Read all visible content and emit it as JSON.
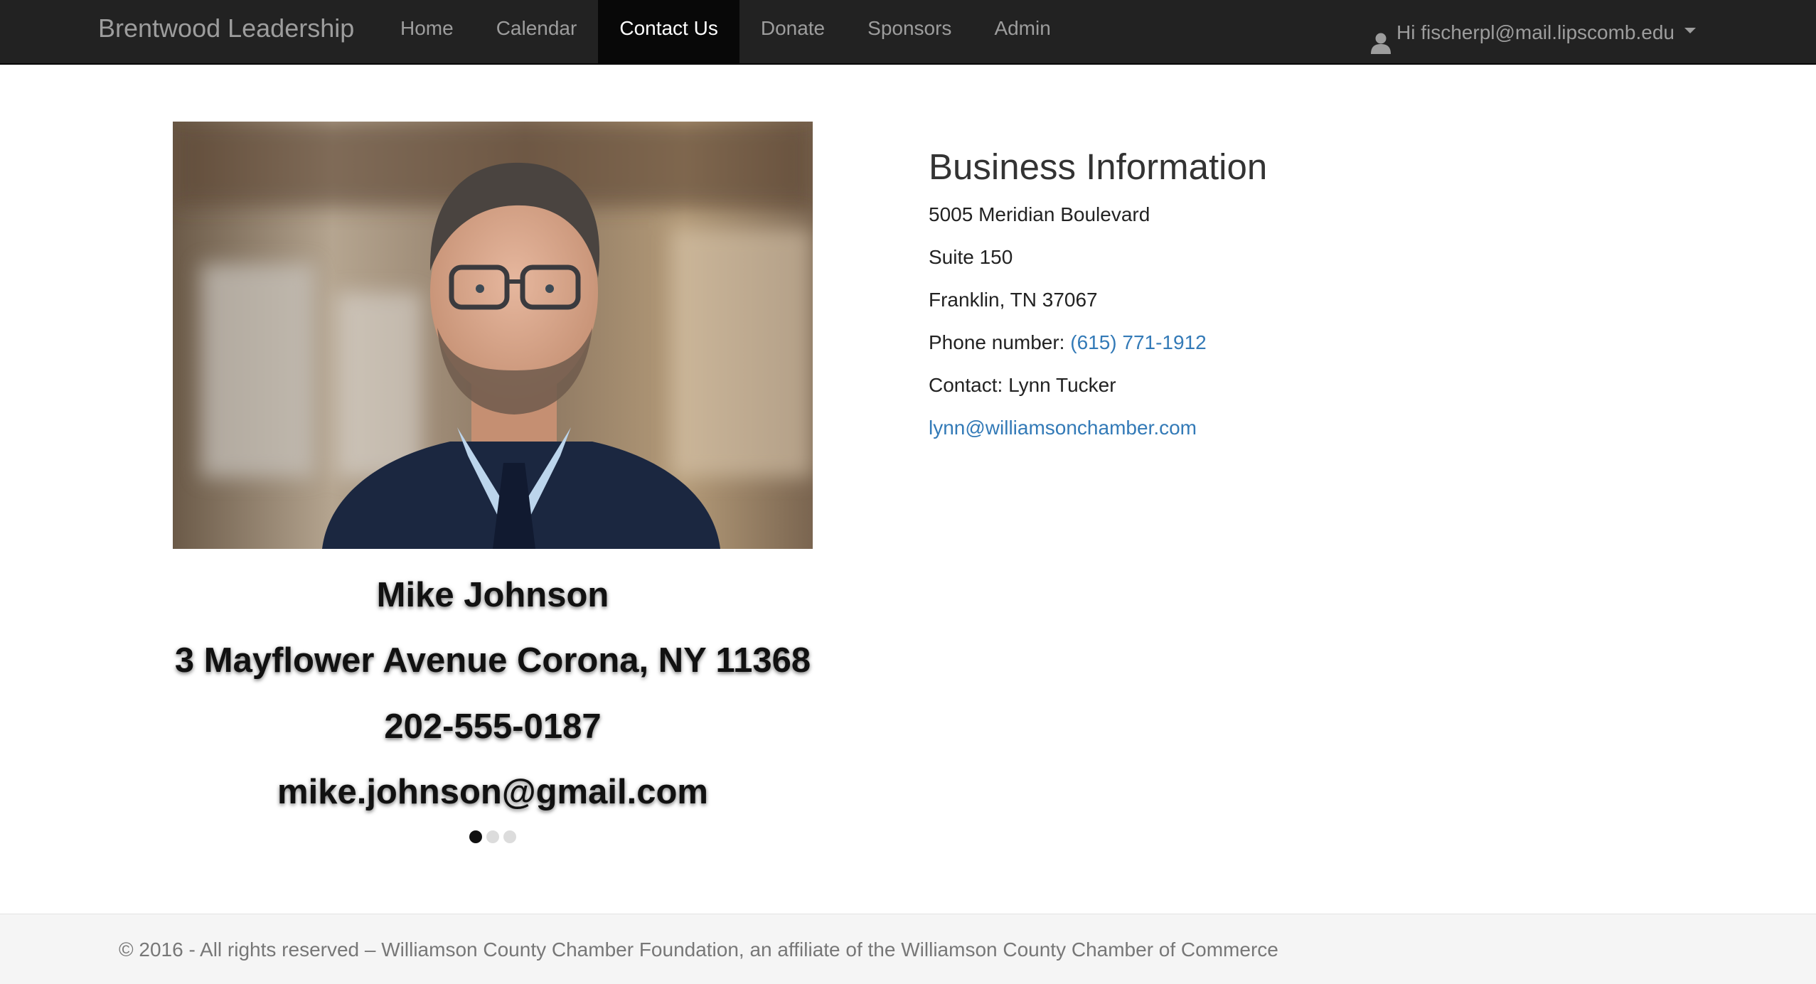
{
  "navbar": {
    "brand": "Brentwood Leadership",
    "items": [
      {
        "label": "Home"
      },
      {
        "label": "Calendar"
      },
      {
        "label": "Contact Us",
        "active": true
      },
      {
        "label": "Donate"
      },
      {
        "label": "Sponsors"
      },
      {
        "label": "Admin"
      }
    ],
    "user_greeting": "Hi fischerpl@mail.lipscomb.edu"
  },
  "carousel": {
    "name": "Mike Johnson",
    "address": "3 Mayflower Avenue Corona, NY 11368",
    "phone": "202-555-0187",
    "email": "mike.johnson@gmail.com",
    "slide_count": 3,
    "active_slide": 1
  },
  "business": {
    "title": "Business Information",
    "street": "5005 Meridian Boulevard",
    "suite": "Suite 150",
    "city": "Franklin, TN 37067",
    "phone_label": "Phone number:",
    "phone": "(615) 771-1912",
    "contact_label": "Contact:",
    "contact_name": "Lynn Tucker",
    "email": "lynn@williamsonchamber.com"
  },
  "footer": {
    "text": "© 2016 - All rights reserved – Williamson County Chamber Foundation, an affiliate of the Williamson County Chamber of Commerce"
  },
  "colors": {
    "navbar_bg": "#222222",
    "nav_active_bg": "#080808",
    "link": "#337ab7",
    "footer_bg": "#f5f5f5"
  },
  "icons": {
    "user": "user-icon",
    "caret": "caret-down-icon"
  }
}
